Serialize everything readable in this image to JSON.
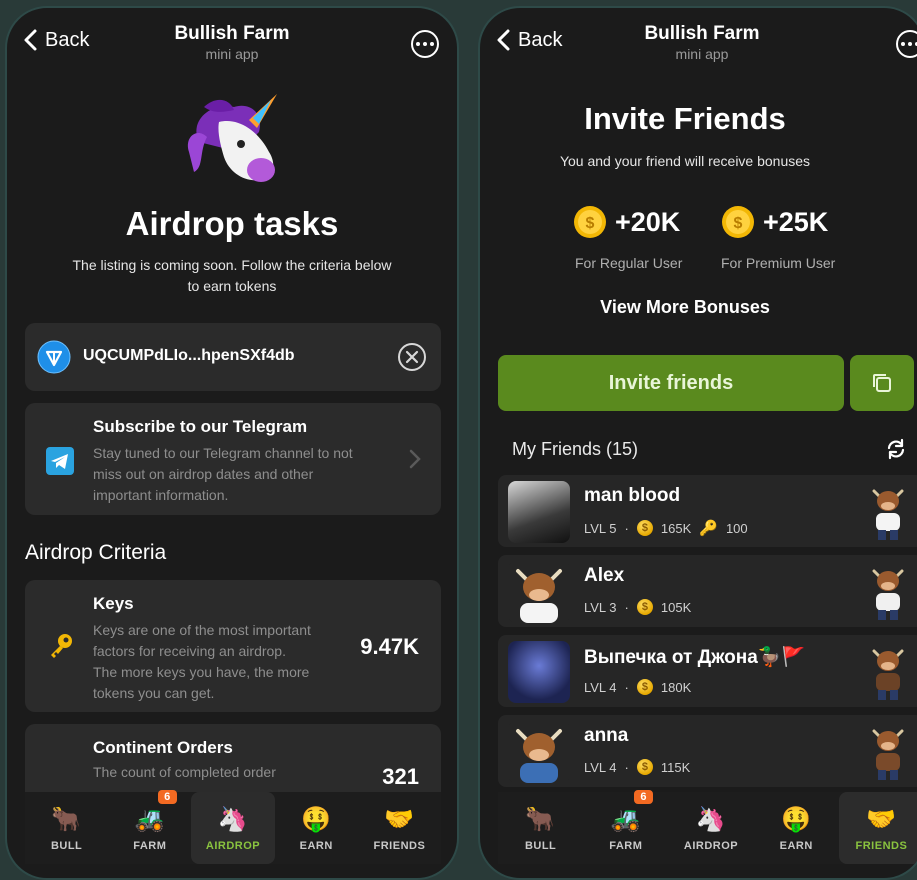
{
  "left_screen": {
    "header": {
      "back_label": "Back",
      "app_title": "Bullish Farm",
      "app_subtitle": "mini app"
    },
    "hero": {
      "title": "Airdrop tasks",
      "subtitle_line1": "The listing is coming soon. Follow the criteria below",
      "subtitle_line2": "to earn tokens"
    },
    "wallet": {
      "address": "UQCUMPdLIo...hpenSXf4db"
    },
    "telegram_task": {
      "title": "Subscribe to our Telegram",
      "desc_line1": "Stay tuned to our Telegram channel to not",
      "desc_line2": "miss out on airdrop dates and other",
      "desc_line3": "important information."
    },
    "criteria_heading": "Airdrop Criteria",
    "keys_card": {
      "title": "Keys",
      "desc_line1": "Keys are one of the most important",
      "desc_line2": "factors for receiving an airdrop.",
      "desc_line3": "The more keys you have, the more",
      "desc_line4": "tokens you can get.",
      "value": "9.47K"
    },
    "orders_card": {
      "title": "Continent Orders",
      "desc_line1": "The count of completed order",
      "value": "321"
    },
    "nav": [
      {
        "label": "BULL",
        "icon": "bull-icon"
      },
      {
        "label": "FARM",
        "icon": "tractor-icon",
        "badge": "6"
      },
      {
        "label": "AIRDROP",
        "icon": "unicorn-icon"
      },
      {
        "label": "EARN",
        "icon": "money-face-icon"
      },
      {
        "label": "FRIENDS",
        "icon": "handshake-icon"
      }
    ],
    "active_tab": "AIRDROP"
  },
  "right_screen": {
    "header": {
      "back_label": "Back",
      "app_title": "Bullish Farm",
      "app_subtitle": "mini app"
    },
    "title": "Invite Friends",
    "subtitle": "You and your friend will receive bonuses",
    "bonus_regular": {
      "amount": "+20K",
      "label": "For Regular User"
    },
    "bonus_premium": {
      "amount": "+25K",
      "label": "For Premium User"
    },
    "view_more": "View More Bonuses",
    "invite_button": "Invite friends",
    "friends_heading": "My Friends (15)",
    "friends": [
      {
        "name": "man blood",
        "level": "LVL 5",
        "coins": "165K",
        "keys": "100"
      },
      {
        "name": "Alex",
        "level": "LVL 3",
        "coins": "105K"
      },
      {
        "name": "Выпечка от Джона🦆🚩",
        "level": "LVL 4",
        "coins": "180K"
      },
      {
        "name": "anna",
        "level": "LVL 4",
        "coins": "115K"
      }
    ],
    "nav": [
      {
        "label": "BULL",
        "icon": "bull-icon"
      },
      {
        "label": "FARM",
        "icon": "tractor-icon",
        "badge": "6"
      },
      {
        "label": "AIRDROP",
        "icon": "unicorn-icon"
      },
      {
        "label": "EARN",
        "icon": "money-face-icon"
      },
      {
        "label": "FRIENDS",
        "icon": "handshake-icon"
      }
    ],
    "active_tab": "FRIENDS"
  },
  "colors": {
    "accent_green": "#5a8a1e",
    "active_green": "#8ac43f",
    "badge_orange": "#f36a22",
    "coin_gold": "#f2b705"
  }
}
